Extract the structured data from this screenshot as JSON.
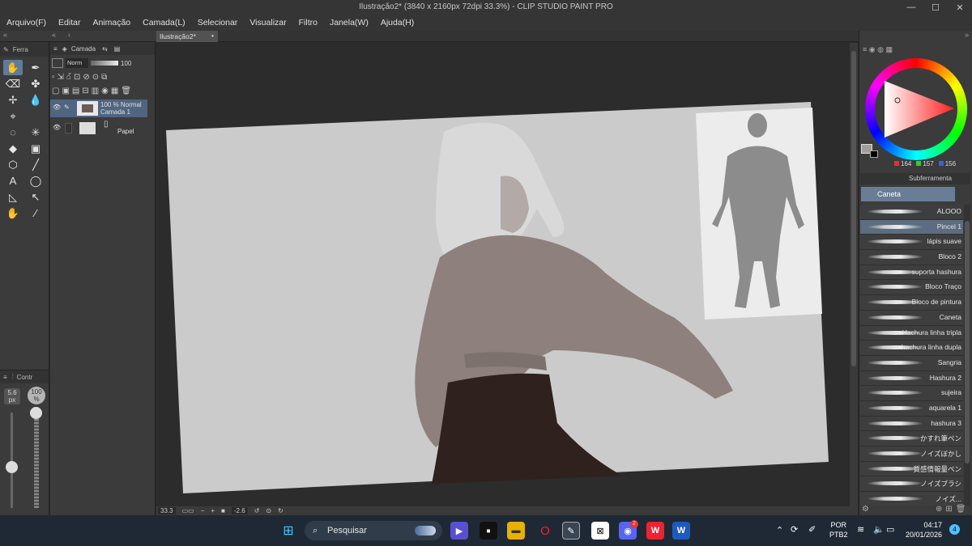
{
  "window": {
    "title": "Ilustração2* (3840 x 2160px 72dpi 33.3%)  - CLIP STUDIO PAINT PRO"
  },
  "menu": [
    "Arquivo(F)",
    "Editar",
    "Animação",
    "Camada(L)",
    "Selecionar",
    "Visualizar",
    "Filtro",
    "Janela(W)",
    "Ajuda(H)"
  ],
  "document_tab": {
    "label": "Ilustração2*"
  },
  "tool_panel": {
    "title": "Ferra"
  },
  "layer_panel": {
    "title": "Camada",
    "blend_mode": "Norm",
    "opacity": "100",
    "layers": [
      {
        "line1": "100 % Normal",
        "line2": "Camada 1",
        "selected": true
      },
      {
        "line1": "",
        "line2": "Papel",
        "selected": false
      }
    ]
  },
  "brush_size_panel": {
    "title": "Contr",
    "size": "5.6",
    "size_unit": "px",
    "opacity": "100",
    "opacity_unit": "%"
  },
  "status_bar": {
    "zoom": "33.3",
    "rotation": "-2.6"
  },
  "color": {
    "r": "164",
    "g": "157",
    "b": "156",
    "current": "#a49d9c"
  },
  "sub_tool": {
    "title": "Subferramenta",
    "group": "Caneta",
    "brushes": [
      "ALOOO",
      "Pincel 1",
      "lápis suave",
      "Bloco 2",
      "suporta hashura",
      "Bloco Traço",
      "Bloco de pintura",
      "Caneta",
      "Hachura linha tripla",
      "hachura linha dupla",
      "Sangria",
      "Hashura 2",
      "sujeira",
      "aquarela 1",
      "hashura 3",
      "かすれ筆ペン",
      "ノイズぼかし",
      "質感情報量ペン",
      "ノイズブラシ",
      "ノイズ..."
    ],
    "selected_index": 1
  },
  "taskbar": {
    "search_placeholder": "Pesquisar",
    "language": "POR",
    "layout": "PTB2",
    "time": "04:17",
    "date": "20/01/2026",
    "notification_count": "4",
    "discord_badge": "2"
  }
}
